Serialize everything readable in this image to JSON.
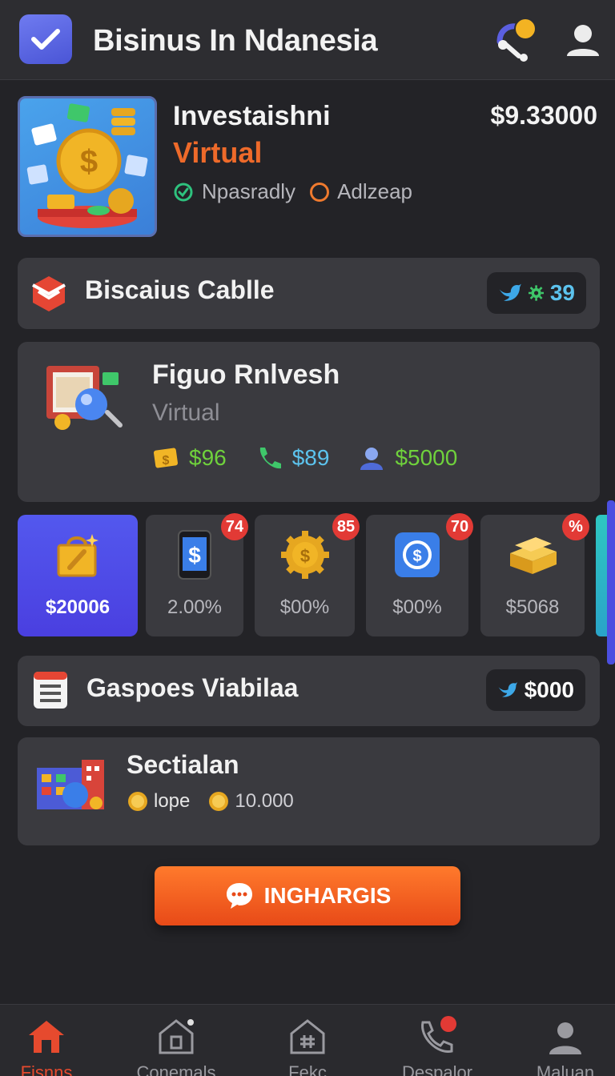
{
  "header": {
    "title": "Bisinus In Ndanesia",
    "logo_icon": "check-icon",
    "actions": [
      "headset-icon",
      "user-icon"
    ]
  },
  "hero": {
    "title": "Investaishni",
    "subtitle": "Virtual",
    "price": "$9.33000",
    "tags": [
      {
        "label": "Npasradly",
        "icon": "check-circle-icon",
        "color": "#2ec27e"
      },
      {
        "label": "Adlzeap",
        "icon": "ring-icon",
        "color": "#ef7a2e"
      }
    ]
  },
  "section1": {
    "title": "Biscaius Cablle",
    "icon": "cube-icon",
    "pill": {
      "icon": "bird-icon",
      "gear_icon": "gear-icon",
      "value": "39"
    }
  },
  "feature": {
    "title": "Figuo Rnlvesh",
    "subtitle": "Virtual",
    "stats": [
      {
        "icon": "money-icon",
        "value": "$96",
        "color": "#6fd13c"
      },
      {
        "icon": "phone-icon",
        "value": "$89",
        "color": "#5cc3ee"
      },
      {
        "icon": "person-icon",
        "value": "$5000",
        "color": "#6fd13c"
      }
    ]
  },
  "tiles": [
    {
      "value": "$20006",
      "icon": "gift-bag-icon",
      "badge": "",
      "active": true
    },
    {
      "value": "2.00%",
      "icon": "phone-dollar-icon",
      "badge": "74"
    },
    {
      "value": "$00%",
      "icon": "gear-coin-icon",
      "badge": "85"
    },
    {
      "value": "$00%",
      "icon": "coin-app-icon",
      "badge": "70"
    },
    {
      "value": "$5068",
      "icon": "gold-bars-icon",
      "badge": "%"
    }
  ],
  "section2": {
    "title": "Gaspoes Viabilaa",
    "icon": "document-icon",
    "pill": {
      "icon": "bird-icon",
      "value": "$000"
    }
  },
  "section3": {
    "title": "Sectialan",
    "items": [
      {
        "icon": "coin-icon",
        "value": "lope"
      },
      {
        "icon": "coin-icon",
        "value": "10.000"
      }
    ]
  },
  "cta": {
    "label": "INGHARGIS",
    "icon": "chat-icon"
  },
  "nav": [
    {
      "label": "Fisnns",
      "icon": "home-icon",
      "active": true
    },
    {
      "label": "Conemals",
      "icon": "house-doc-icon"
    },
    {
      "label": "Fekc",
      "icon": "house-hash-icon"
    },
    {
      "label": "Despalor",
      "icon": "phone-icon"
    },
    {
      "label": "Maluan",
      "icon": "user-icon"
    }
  ]
}
